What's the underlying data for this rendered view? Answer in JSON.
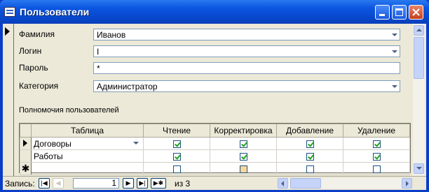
{
  "window": {
    "title": "Пользователи"
  },
  "form": {
    "fields": [
      {
        "label": "Фамилия",
        "value": "Иванов"
      },
      {
        "label": "Логин",
        "value": "I"
      },
      {
        "label": "Пароль",
        "value": "*"
      },
      {
        "label": "Категория",
        "value": "Администратор"
      }
    ],
    "permissions_label": "Полномочия пользователей"
  },
  "grid": {
    "columns": [
      "Таблица",
      "Чтение",
      "Корректировка",
      "Добавление",
      "Удаление"
    ],
    "rows": [
      {
        "table": "Договоры",
        "read": true,
        "edit": true,
        "add": true,
        "delete": true
      },
      {
        "table": "Работы",
        "read": true,
        "edit": true,
        "add": true,
        "delete": true
      },
      {
        "table": "",
        "read": false,
        "edit": false,
        "add": false,
        "delete": false
      }
    ]
  },
  "navigation": {
    "record_label": "Запись:",
    "current_record": "1",
    "of_label": "из 3"
  }
}
